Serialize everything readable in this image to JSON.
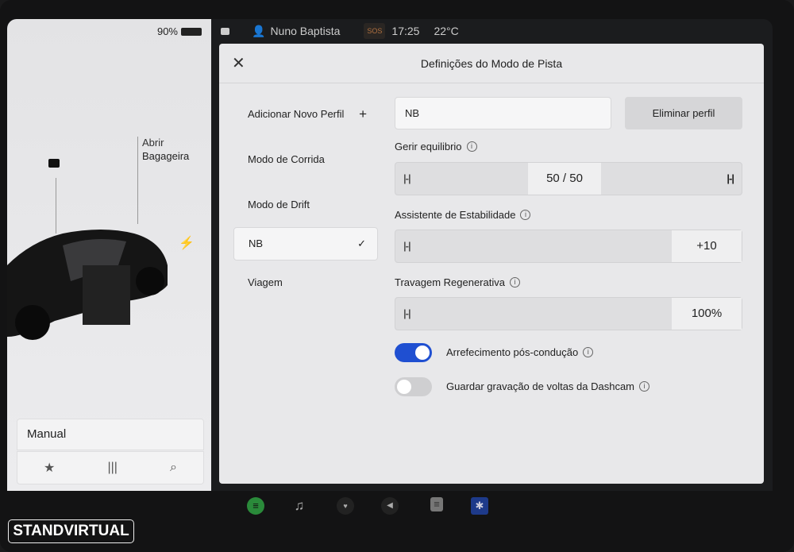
{
  "status": {
    "battery": "90%",
    "user": "Nuno Baptista",
    "sos": "SOS",
    "time": "17:25",
    "temp": "22°C"
  },
  "left": {
    "trunk": "Abrir\nBagageira",
    "trunk1": "Abrir",
    "trunk2": "Bagageira",
    "mode": "Manual"
  },
  "modal": {
    "title": "Definições do Modo de Pista",
    "menu": [
      {
        "label": "Adicionar Novo Perfil",
        "suffix": "+"
      },
      {
        "label": "Modo de Corrida"
      },
      {
        "label": "Modo de Drift"
      },
      {
        "label": "NB",
        "suffix": "✓"
      },
      {
        "label": "Viagem"
      }
    ],
    "profile_name": "NB",
    "delete_label": "Eliminar perfil",
    "balance_label": "Gerir equilibrio",
    "balance_value": "50 / 50",
    "stability_label": "Assistente de Estabilidade",
    "stability_value": "+10",
    "regen_label": "Travagem Regenerativa",
    "regen_value": "100%",
    "cooldown_label": "Arrefecimento pós-condução",
    "cooldown_on": true,
    "dashcam_label": "Guardar gravação de voltas da Dashcam",
    "dashcam_on": false
  },
  "brand": "STANDVIRTUAL",
  "colors": {
    "accent": "#1f4fd1",
    "spotify": "#2a8a3a",
    "bluetooth": "#1e3a8a"
  }
}
